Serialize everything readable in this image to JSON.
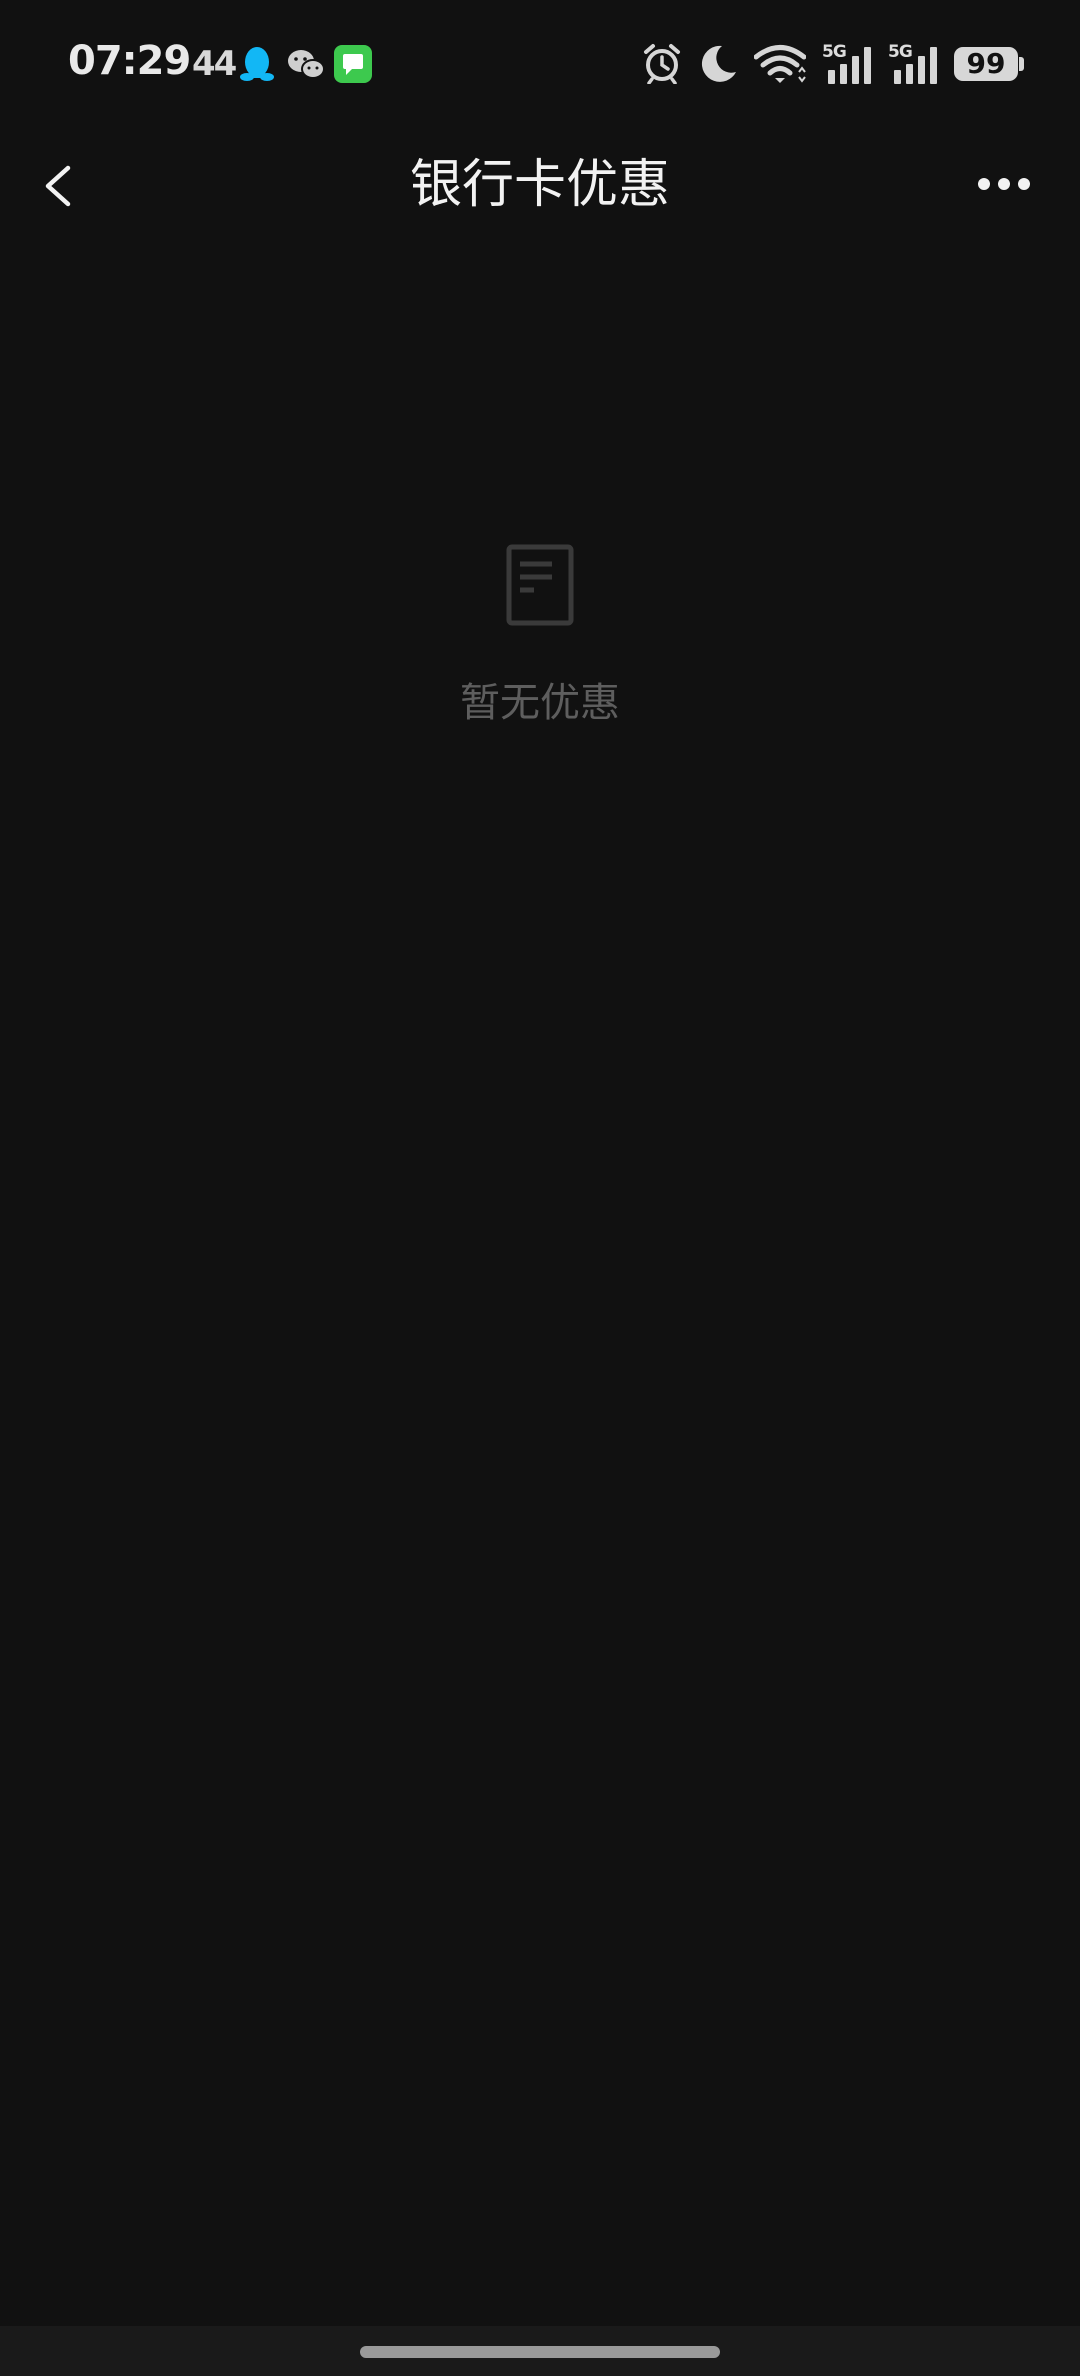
{
  "status_bar": {
    "time": "07:29",
    "network_speed": "44",
    "signal_label_1": "5G",
    "signal_label_2": "5G",
    "battery_level": "99",
    "icons": [
      "qq-icon",
      "wechat-icon",
      "message-app-icon",
      "alarm-icon",
      "moon-icon",
      "wifi-icon",
      "signal-icon",
      "battery-icon"
    ],
    "colors": {
      "qq": "#12B7F5",
      "message_app": "#3DC94E"
    }
  },
  "nav_bar": {
    "title": "银行卡优惠",
    "back_icon": "chevron-left-icon",
    "more_icon": "more-dots-icon"
  },
  "empty_state": {
    "icon": "document-icon",
    "message": "暂无优惠"
  },
  "theme": {
    "background": "#111111",
    "title_color": "#f2f2f2",
    "empty_text_color": "#5e5e5e"
  }
}
